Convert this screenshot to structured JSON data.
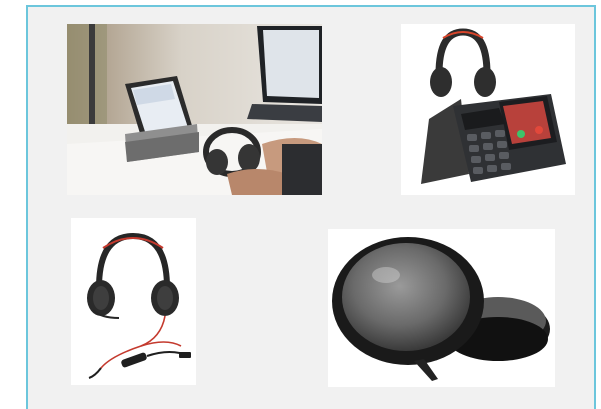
{
  "products": [
    {
      "icon": "desk-headset-laptop-photo-icon"
    },
    {
      "icon": "headset-desk-phone-photo-icon"
    },
    {
      "icon": "corded-headset-photo-icon"
    },
    {
      "icon": "speakerphone-photo-icon"
    }
  ]
}
